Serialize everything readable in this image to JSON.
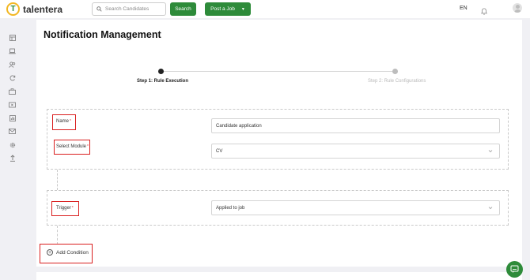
{
  "brand": {
    "name": "talentera",
    "mark": "T"
  },
  "header": {
    "search_placeholder": "Search Candidates",
    "search_button": "Search",
    "post_job_button": "Post a Job",
    "language": "EN"
  },
  "sidebar": {
    "icons": [
      "dashboard-icon",
      "laptop-icon",
      "users-icon",
      "refresh-icon",
      "briefcase-icon",
      "video-icon",
      "chart-icon",
      "mail-icon",
      "gear-icon",
      "upload-icon"
    ]
  },
  "page": {
    "title": "Notification Management"
  },
  "stepper": {
    "steps": [
      {
        "label": "Step 1: Rule Execution",
        "active": true
      },
      {
        "label": "Step 2: Rule Configurations",
        "active": false
      }
    ]
  },
  "form": {
    "name": {
      "label": "Name",
      "required_mark": "*",
      "value": "Candidate application"
    },
    "module": {
      "label": "Select Module",
      "required_mark": "*",
      "value": "CV"
    },
    "trigger": {
      "label": "Trigger",
      "required_mark": "*",
      "value": "Applied to job"
    }
  },
  "actions": {
    "add_condition": "Add Condition"
  },
  "colors": {
    "brand_green": "#2e8b3a",
    "highlight_red": "#d91e1e",
    "logo_yellow": "#f2b722"
  }
}
